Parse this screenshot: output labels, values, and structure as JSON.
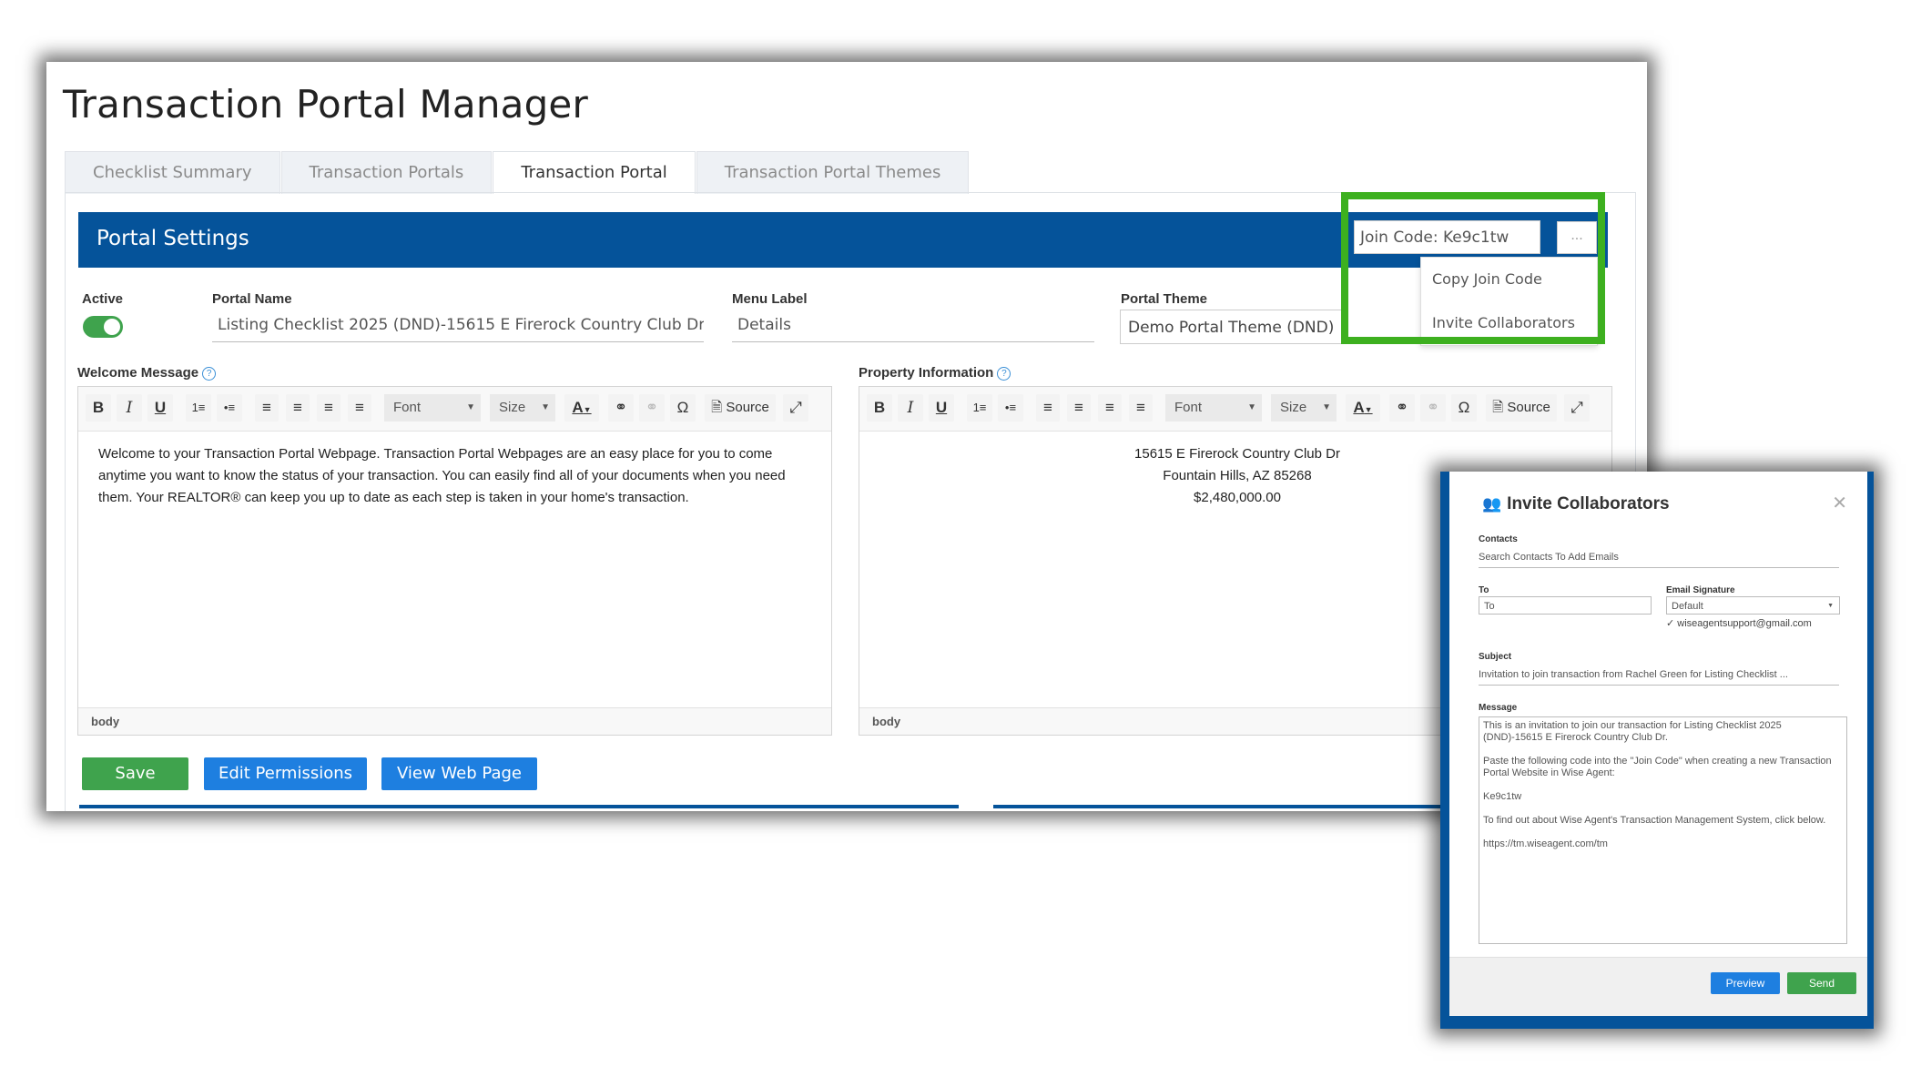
{
  "page_title": "Transaction Portal Manager",
  "tabs": [
    {
      "label": "Checklist Summary"
    },
    {
      "label": "Transaction Portals"
    },
    {
      "label": "Transaction Portal"
    },
    {
      "label": "Transaction Portal Themes"
    }
  ],
  "settings": {
    "title": "Portal Settings",
    "active_label": "Active",
    "portal_name_label": "Portal Name",
    "portal_name_value": "Listing Checklist 2025 (DND)-15615 E Firerock Country Club Dr",
    "menu_label_label": "Menu Label",
    "menu_label_value": "Details",
    "portal_theme_label": "Portal Theme",
    "portal_theme_value": "Demo Portal Theme (DND)"
  },
  "join": {
    "code_text": "Join Code: Ke9c1tw",
    "dots": "...",
    "menu": [
      "Copy Join Code",
      "Invite Collaborators"
    ]
  },
  "welcome": {
    "label": "Welcome Message",
    "text": "Welcome to your Transaction Portal Webpage. Transaction Portal Webpages are an easy place for you to come anytime you want to know the status of your transaction. You can easily find all of your documents when you need them. Your REALTOR® can keep you up to date as each step is taken in your home's transaction."
  },
  "property": {
    "label": "Property Information",
    "line1": "15615 E Firerock Country Club Dr",
    "line2": "Fountain Hills, AZ 85268",
    "line3": "$2,480,000.00"
  },
  "toolbar": {
    "bold": "B",
    "italic": "I",
    "underline": "U",
    "font": "Font",
    "size": "Size",
    "color": "A",
    "omega": "Ω",
    "source": "Source"
  },
  "editor_footer": "body",
  "buttons": {
    "save": "Save",
    "edit_permissions": "Edit Permissions",
    "view_web_page": "View Web Page"
  },
  "modal": {
    "title": "Invite Collaborators",
    "contacts_label": "Contacts",
    "contacts_placeholder": "Search Contacts To Add Emails",
    "to_label": "To",
    "to_placeholder": "To",
    "signature_label": "Email Signature",
    "signature_value": "Default",
    "signature_email": "wiseagentsupport@gmail.com",
    "subject_label": "Subject",
    "subject_value": "Invitation to join transaction from Rachel Green  for Listing Checklist ...",
    "message_label": "Message",
    "message_p1": "This is an invitation to join our transaction for Listing Checklist 2025 (DND)-15615 E Firerock Country Club Dr.",
    "message_p2": "Paste the following code into the \"Join Code\" when creating a new Transaction Portal Website in Wise Agent:",
    "message_p3": "Ke9c1tw",
    "message_p4": "To find out about Wise Agent's Transaction Management System, click below.",
    "message_p5": "https://tm.wiseagent.com/tm",
    "preview": "Preview",
    "send": "Send"
  },
  "colors": {
    "brand_blue": "#05539a",
    "button_blue": "#1e7fe0",
    "green": "#3fa34d",
    "highlight_green": "#3db01f"
  }
}
